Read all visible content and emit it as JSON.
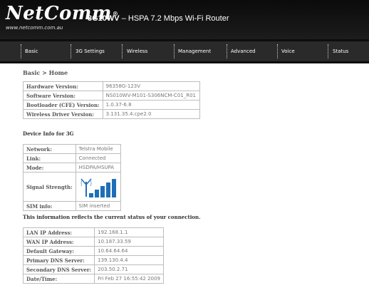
{
  "header": {
    "logo_text": "NetComm",
    "logo_mark": "®",
    "logo_url": "www.netcomm.com.au",
    "product_model": "3G10WV",
    "product_desc": " – HSPA 7.2 Mbps Wi-Fi Router"
  },
  "nav": {
    "items": [
      {
        "label": "Basic"
      },
      {
        "label": "3G Settings"
      },
      {
        "label": "Wireless"
      },
      {
        "label": "Management"
      },
      {
        "label": "Advanced"
      },
      {
        "label": "Voice"
      },
      {
        "label": "Status"
      }
    ]
  },
  "breadcrumb": "Basic > Home",
  "version_table": [
    {
      "label": "Hardware Version:",
      "value": "96358G-123V"
    },
    {
      "label": "Software Version:",
      "value": "NS010WV-M101-S306NCM-C01_R01"
    },
    {
      "label": "Bootloader (CFE) Version:",
      "value": "1.0.37-6.8"
    },
    {
      "label": "Wireless Driver Version:",
      "value": "3.131.35.4.cpe2.0"
    }
  ],
  "device_info_title": "Device Info for 3G",
  "device_table": {
    "network": {
      "label": "Network:",
      "value": "Telstra Mobile"
    },
    "link": {
      "label": "Link:",
      "value": "Connected"
    },
    "mode": {
      "label": "Mode:",
      "value": "HSDPA/HSUPA"
    },
    "signal": {
      "label": "Signal Strength:",
      "level": 5,
      "max": 5,
      "icon": "signal-strength-icon",
      "color": "#1e6fb8"
    },
    "sim": {
      "label": "SIM info:",
      "value": "SIM inserted"
    }
  },
  "status_note": "This information reflects the current status of your connection.",
  "connection_table": [
    {
      "label": "LAN IP Address:",
      "value": "192.168.1.1"
    },
    {
      "label": "WAN IP Address:",
      "value": "10.187.33.59"
    },
    {
      "label": "Default Gateway:",
      "value": "10.64.64.64"
    },
    {
      "label": "Primary DNS Server:",
      "value": "139.130.4.4"
    },
    {
      "label": "Secondary DNS Server:",
      "value": "203.50.2.71"
    },
    {
      "label": "Date/Time:",
      "value": "Fri Feb 27 16:55:42 2009"
    }
  ]
}
